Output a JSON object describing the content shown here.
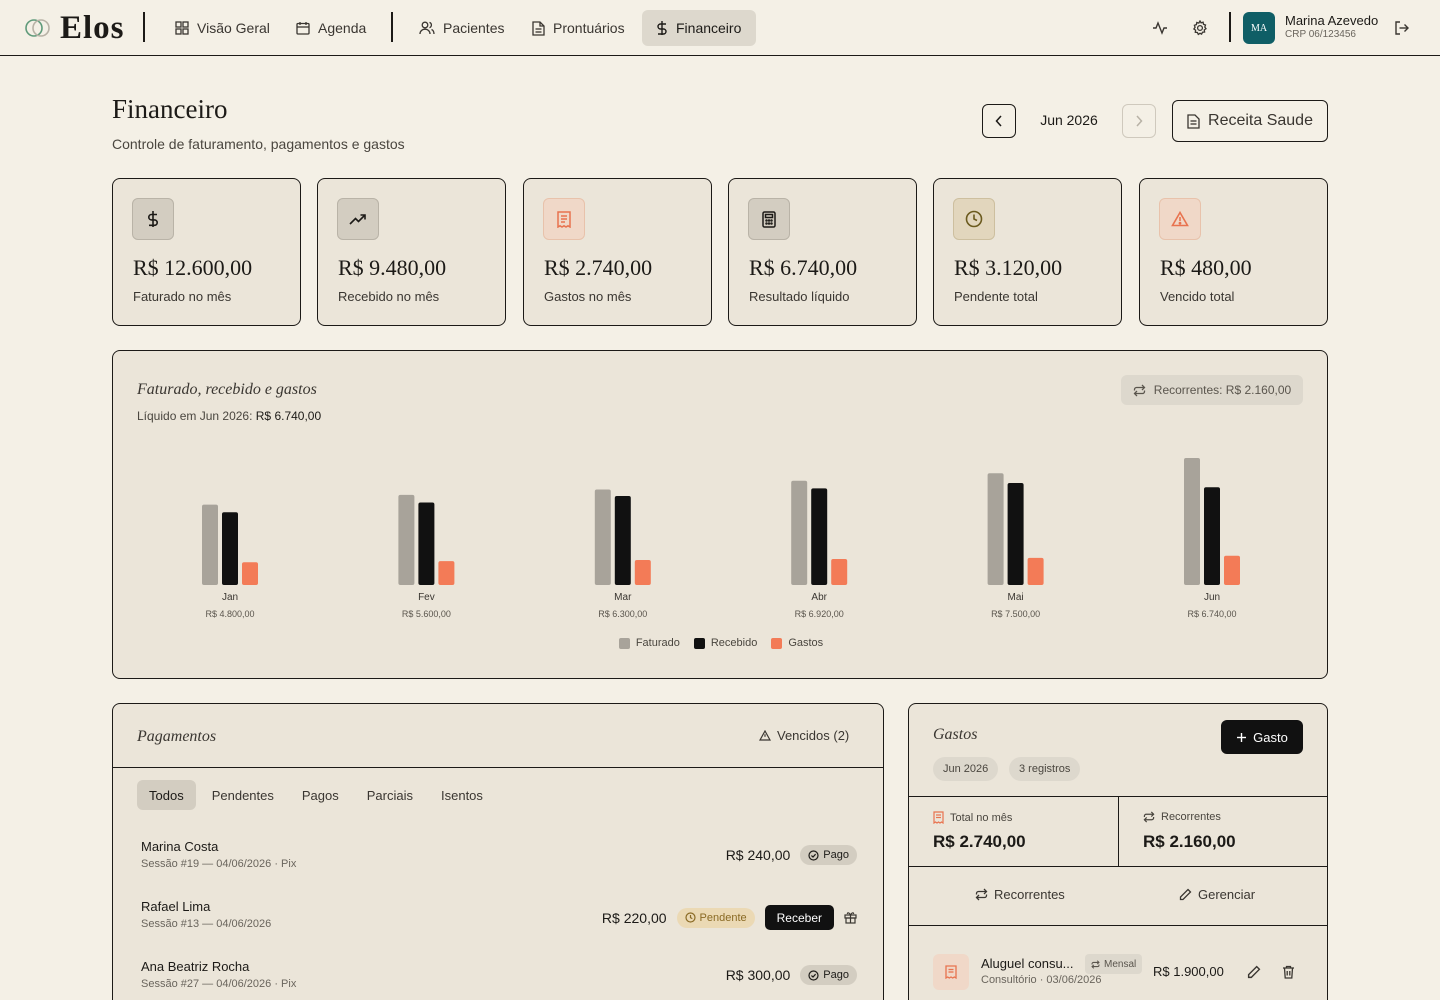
{
  "app": {
    "name": "Elos"
  },
  "nav": {
    "items": [
      {
        "label": "Visão Geral"
      },
      {
        "label": "Agenda"
      },
      {
        "label": "Pacientes"
      },
      {
        "label": "Prontuários"
      },
      {
        "label": "Financeiro"
      }
    ],
    "active": "Financeiro"
  },
  "user": {
    "initials": "MA",
    "name": "Marina Azevedo",
    "crp": "CRP 06/123456"
  },
  "header": {
    "title": "Financeiro",
    "subtitle": "Controle de faturamento, pagamentos e gastos",
    "month": "Jun 2026",
    "receita_label": "Receita Saude"
  },
  "stats": [
    {
      "value": "R$ 12.600,00",
      "label": "Faturado no mês",
      "icon": "dollar-icon",
      "color": "#1c1a17"
    },
    {
      "value": "R$ 9.480,00",
      "label": "Recebido no mês",
      "icon": "trending-up-icon",
      "color": "#1c1a17"
    },
    {
      "value": "R$ 2.740,00",
      "label": "Gastos no mês",
      "icon": "receipt-icon",
      "color": "#e8734f"
    },
    {
      "value": "R$ 6.740,00",
      "label": "Resultado líquido",
      "icon": "calculator-icon",
      "color": "#1c1a17"
    },
    {
      "value": "R$ 3.120,00",
      "label": "Pendente total",
      "icon": "clock-icon",
      "color": "#6b5a1e"
    },
    {
      "value": "R$ 480,00",
      "label": "Vencido total",
      "icon": "alert-triangle-icon",
      "color": "#e8734f"
    }
  ],
  "chart": {
    "title": "Faturado, recebido e gastos",
    "liquido_prefix": "Líquido em Jun 2026:",
    "liquido_value": "R$ 6.740,00",
    "recorrentes_badge": "Recorrentes: R$ 2.160,00"
  },
  "chart_data": {
    "type": "bar",
    "title": "Faturado, recebido e gastos",
    "categories": [
      "Jan",
      "Fev",
      "Mar",
      "Abr",
      "Mai",
      "Jun"
    ],
    "category_labels": [
      "R$ 4.800,00",
      "R$ 5.600,00",
      "R$ 6.300,00",
      "R$ 6.920,00",
      "R$ 7.500,00",
      "R$ 6.740,00"
    ],
    "series": [
      {
        "name": "Faturado",
        "color": "#a8a39a",
        "values": [
          7400,
          8300,
          8800,
          9600,
          10300,
          11700
        ]
      },
      {
        "name": "Recebido",
        "color": "#111111",
        "values": [
          6700,
          7600,
          8200,
          8900,
          9400,
          9000
        ]
      },
      {
        "name": "Gastos",
        "color": "#f37b57",
        "values": [
          2100,
          2200,
          2300,
          2400,
          2500,
          2700
        ]
      }
    ],
    "grid": false,
    "legend": "bottom-center"
  },
  "pagamentos": {
    "title": "Pagamentos",
    "vencidos_label": "Vencidos (2)",
    "tabs": [
      "Todos",
      "Pendentes",
      "Pagos",
      "Parciais",
      "Isentos"
    ],
    "active_tab": "Todos",
    "rows": [
      {
        "name": "Marina Costa",
        "info": "Sessão #19 — 04/06/2026 · Pix",
        "amount": "R$ 240,00",
        "status": "Pago"
      },
      {
        "name": "Rafael Lima",
        "info": "Sessão #13 — 04/06/2026",
        "amount": "R$ 220,00",
        "status": "Pendente",
        "action": "Receber"
      },
      {
        "name": "Ana Beatriz Rocha",
        "info": "Sessão #27 — 04/06/2026 · Pix",
        "amount": "R$ 300,00",
        "status": "Pago"
      }
    ]
  },
  "gastos": {
    "title": "Gastos",
    "add_label": "Gasto",
    "month_pill": "Jun 2026",
    "count_pill": "3 registros",
    "total_label": "Total no mês",
    "total_value": "R$ 2.740,00",
    "rec_label": "Recorrentes",
    "rec_value": "R$ 2.160,00",
    "action_recorrentes": "Recorrentes",
    "action_gerenciar": "Gerenciar",
    "rows": [
      {
        "name": "Aluguel consu...",
        "tag": "Mensal",
        "info": "Consultório · 03/06/2026",
        "amount": "R$ 1.900,00"
      }
    ]
  }
}
